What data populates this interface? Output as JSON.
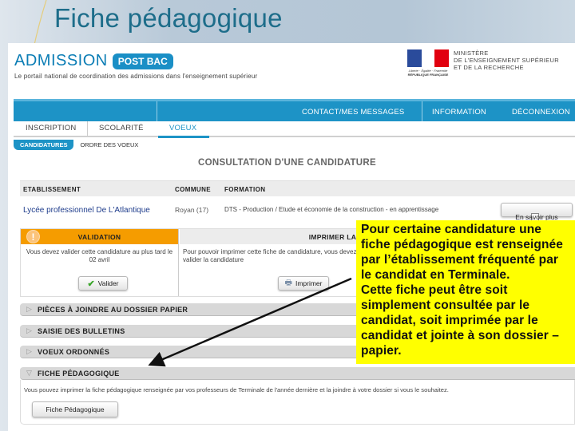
{
  "slide": {
    "title": "Fiche pédagogique"
  },
  "header": {
    "logo_text": "ADMISSION",
    "logo_badge": "POST BAC",
    "tagline": "Le portail national de coordination des admissions dans l'enseignement supérieur",
    "ministry": {
      "motto": "Liberté · Égalité · Fraternité",
      "republic": "RÉPUBLIQUE FRANÇAISE",
      "line1": "MINISTÈRE",
      "line2": "DE L'ENSEIGNEMENT SUPÉRIEUR",
      "line3": "ET DE LA RECHERCHE"
    }
  },
  "nav": {
    "top_items": [
      "CONTACT/MES MESSAGES",
      "INFORMATION",
      "DÉCONNEXION"
    ],
    "tabs": [
      "INSCRIPTION",
      "SCOLARITÉ",
      "VOEUX"
    ],
    "active_tab": "VOEUX",
    "subtabs": [
      "CANDIDATURES",
      "ORDRE DES VOEUX"
    ],
    "active_subtab": "CANDIDATURES"
  },
  "main": {
    "heading": "CONSULTATION D'UNE CANDIDATURE",
    "table": {
      "columns": [
        "ETABLISSEMENT",
        "COMMUNE",
        "FORMATION"
      ],
      "row": {
        "etablissement": "Lycée professionnel De L'Atlantique",
        "commune": "Royan (17)",
        "formation": "DTS - Production / Etude et économie de la construction - en apprentissage",
        "more_button": "En savoir plus"
      }
    },
    "validation": {
      "title": "VALIDATION",
      "text": "Vous devez valider cette candidature au plus tard le 02 avril",
      "button": "Valider"
    },
    "print": {
      "title": "IMPRIMER LA FICHE DE CANDIDATURE",
      "text": "Pour pouvoir imprimer cette fiche de candidature, vous devez valider la candidature",
      "button": "Imprimer"
    },
    "accordions": [
      {
        "label": "PIÈCES À JOINDRE AU DOSSIER PAPIER",
        "expanded": false
      },
      {
        "label": "SAISIE DES BULLETINS",
        "expanded": false
      },
      {
        "label": "VOEUX ORDONNÉS",
        "expanded": false
      },
      {
        "label": "FICHE PÉDAGOGIQUE",
        "expanded": true
      }
    ],
    "fiche": {
      "description": "Vous pouvez imprimer la fiche pédagogique renseignée par vos professeurs de Terminale de l'année dernière et la joindre à votre dossier si vous le souhaitez.",
      "button": "Fiche Pédagogique"
    }
  },
  "callout": {
    "lines": [
      "Pour certaine candidature une",
      "fiche pédagogique est renseignée",
      "par l’établissement fréquenté par",
      "le candidat en Terminale.",
      "Cette fiche peut être soit",
      "simplement consultée par le",
      "candidat, soit imprimée par le",
      "candidat et jointe à son dossier –",
      "papier."
    ],
    "background": "#ffff00"
  },
  "colors": {
    "brand_blue": "#1d93c6",
    "validation_orange": "#f59c00",
    "title_teal": "#1d6d8a"
  }
}
